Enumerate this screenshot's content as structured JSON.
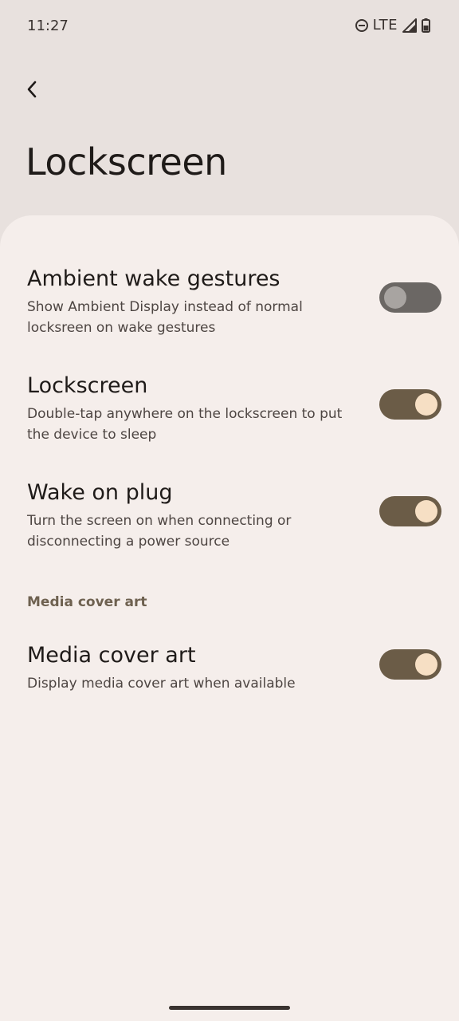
{
  "status_bar": {
    "time": "11:27",
    "network": "LTE",
    "icons": [
      "do-not-disturb-icon",
      "signal-icon",
      "battery-icon"
    ]
  },
  "header": {
    "back_icon": "chevron-left-icon",
    "title": "Lockscreen"
  },
  "settings": [
    {
      "title": "Ambient wake gestures",
      "summary": "Show Ambient Display instead of normal locksreen on wake gestures",
      "enabled": false
    },
    {
      "title": "Lockscreen",
      "summary": "Double-tap anywhere on the lockscreen to put the device to sleep",
      "enabled": true
    },
    {
      "title": "Wake on plug",
      "summary": "Turn the screen on when connecting or disconnecting a power source",
      "enabled": true
    }
  ],
  "media_section": {
    "header": "Media cover art",
    "items": [
      {
        "title": "Media cover art",
        "summary": "Display media cover art when available",
        "enabled": true
      }
    ]
  },
  "colors": {
    "background": "#e8e1de",
    "surface": "#f5eeeb",
    "toggle_on_track": "#6b5c47",
    "toggle_on_thumb": "#f6dfc4",
    "toggle_off_track": "#6b6764",
    "section_header": "#6e6150"
  }
}
